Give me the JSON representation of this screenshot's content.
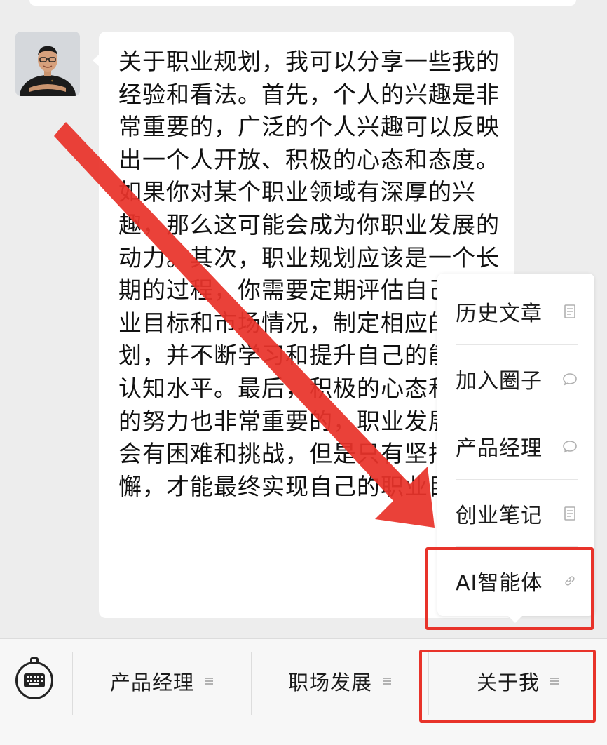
{
  "message": {
    "text": "关于职业规划，我可以分享一些我的经验和看法。首先，个人的兴趣是非常重要的，广泛的个人兴趣可以反映出一个人开放、积极的心态和态度。如果你对某个职业领域有深厚的兴趣，那么这可能会成为你职业发展的动力。其次，职业规划应该是一个长期的过程，你需要定期评估自己的职业目标和市场情况，制定相应的计划，并不断学习和提升自己的能力和认知水平。最后，积极的心态和持续的努力也非常重要的，职业发展中总会有困难和挑战，但是只有坚持不懈，才能最终实现自己的职业目标。"
  },
  "popup_menu": {
    "items": [
      {
        "label": "历史文章",
        "icon": "article-icon"
      },
      {
        "label": "加入圈子",
        "icon": "chat-bubble-icon"
      },
      {
        "label": "产品经理",
        "icon": "chat-bubble-icon"
      },
      {
        "label": "创业笔记",
        "icon": "article-icon"
      },
      {
        "label": "AI智能体",
        "icon": "link-icon"
      }
    ]
  },
  "bottom_menu": {
    "keyboard_icon": "keyboard-icon",
    "tabs": [
      {
        "label": "产品经理",
        "icon": "menu-lines-icon"
      },
      {
        "label": "职场发展",
        "icon": "menu-lines-icon"
      },
      {
        "label": "关于我",
        "icon": "menu-lines-icon"
      }
    ]
  },
  "colors": {
    "annotation_red": "#e8332a",
    "background": "#ededed",
    "bubble": "#ffffff"
  }
}
